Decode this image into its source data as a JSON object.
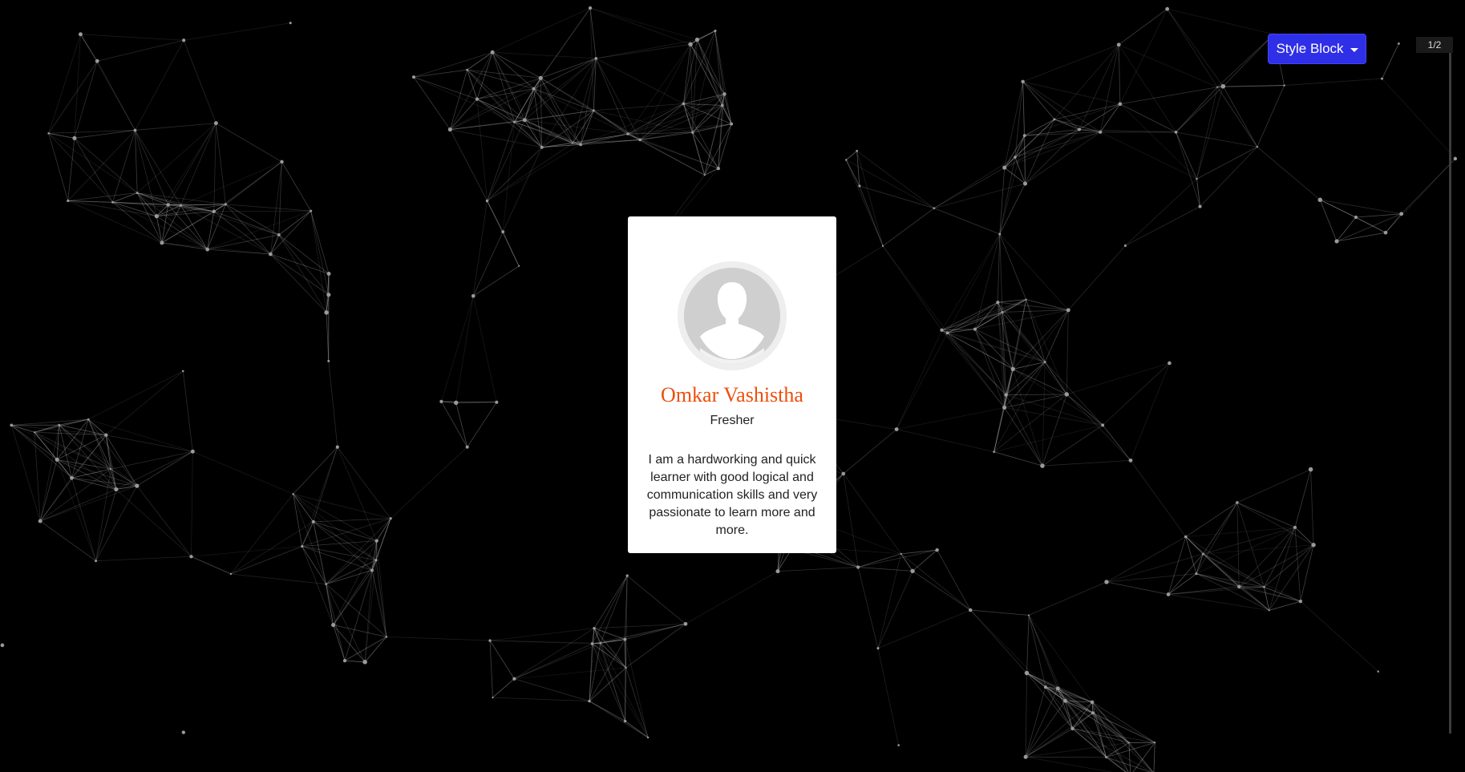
{
  "style_button": {
    "label": "Style Block"
  },
  "scroll": {
    "indicator": "1/2"
  },
  "profile": {
    "name": "Omkar Vashistha",
    "role": "Fresher",
    "bio": "I am a hardworking and quick learner with good logical and communication skills and very passionate to learn more and more."
  },
  "colors": {
    "background": "#000000",
    "accent_button": "#2f2fe8",
    "name_color": "#ee4e0d",
    "card": "#ffffff"
  },
  "icons": {
    "avatar": "user-silhouette-icon",
    "dropdown": "caret-down-icon"
  }
}
